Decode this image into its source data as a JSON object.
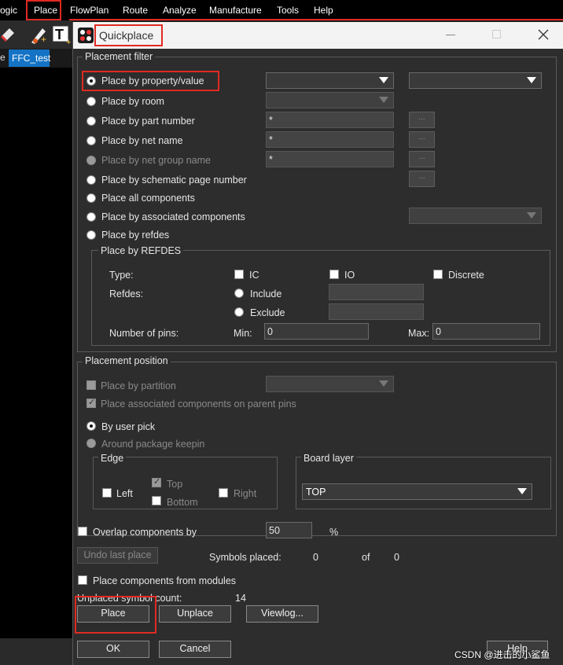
{
  "menubar": {
    "items": [
      "ogic",
      "Place",
      "FlowPlan",
      "Route",
      "Analyze",
      "Manufacture",
      "Tools",
      "Help"
    ]
  },
  "tab": {
    "label": "FFC_test",
    "left_label": "e"
  },
  "dialog": {
    "title": "Quickplace",
    "placement_filter": {
      "label": "Placement filter",
      "options": [
        "Place by property/value",
        "Place by room",
        "Place by part number",
        "Place by net name",
        "Place by net group name",
        "Place by schematic page number",
        "Place all components",
        "Place by associated components",
        "Place by refdes"
      ],
      "part_number_value": "*",
      "net_name_value": "*",
      "net_group_value": "*",
      "browse_label": "...",
      "refdes_group": {
        "label": "Place by REFDES",
        "type_label": "Type:",
        "type_ic": "IC",
        "type_io": "IO",
        "type_discrete": "Discrete",
        "refdes_label": "Refdes:",
        "include": "Include",
        "exclude": "Exclude",
        "pins_label": "Number of pins:",
        "min_label": "Min:",
        "min_value": "0",
        "max_label": "Max:",
        "max_value": "0"
      }
    },
    "placement_position": {
      "label": "Placement position",
      "by_partition": "Place by partition",
      "associated_on_parent": "Place associated components on parent pins",
      "by_user_pick": "By user pick",
      "around_keepin": "Around package keepin",
      "edge": {
        "label": "Edge",
        "left": "Left",
        "top": "Top",
        "bottom": "Bottom",
        "right": "Right"
      },
      "board_layer": {
        "label": "Board layer",
        "value": "TOP"
      }
    },
    "overlap_label": "Overlap components by",
    "overlap_value": "50",
    "overlap_unit": "%",
    "undo_label": "Undo last place",
    "symbols_placed_label": "Symbols placed:",
    "symbols_placed_value": "0",
    "of_label": "of",
    "of_value": "0",
    "modules_label": "Place components from modules",
    "unplaced_label": "Unplaced symbol count:",
    "unplaced_value": "14",
    "buttons": {
      "place": "Place",
      "unplace": "Unplace",
      "viewlog": "Viewlog...",
      "ok": "OK",
      "cancel": "Cancel",
      "help": "Help"
    }
  },
  "watermark": "CSDN @进击的小鲨鱼",
  "colors": {
    "highlight": "#e02a22",
    "tab": "#1473c5"
  }
}
